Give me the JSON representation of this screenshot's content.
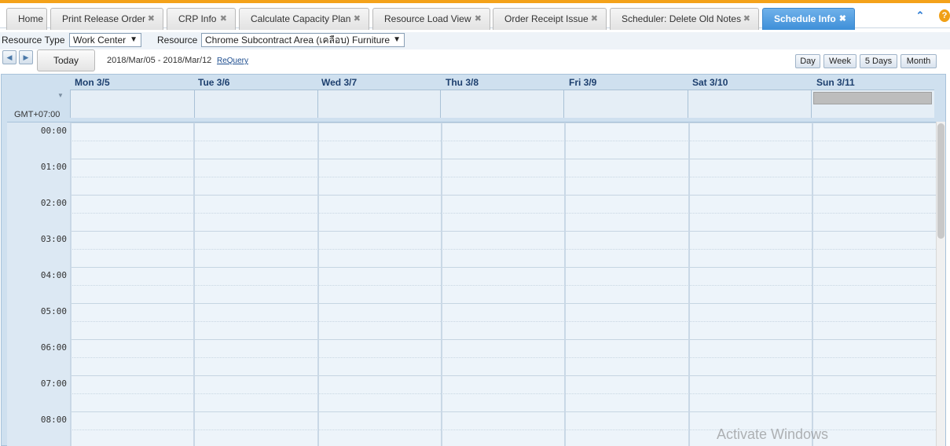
{
  "tabs": [
    {
      "label": "Home",
      "close": ""
    },
    {
      "label": "Print Release Order",
      "close": "✖"
    },
    {
      "label": "CRP Info",
      "close": "✖"
    },
    {
      "label": "Calculate Capacity Plan",
      "close": "✖"
    },
    {
      "label": "Resource Load View",
      "close": "✖"
    },
    {
      "label": "Order Receipt Issue",
      "close": "✖"
    },
    {
      "label": "Scheduler: Delete Old Notes",
      "close": "✖"
    },
    {
      "label": "Schedule Info",
      "close": "✖",
      "active": true
    }
  ],
  "toolbar_icons": {
    "collapse": "⌃",
    "help": "?"
  },
  "filters": {
    "resource_type_label": "Resource Type",
    "resource_type_value": "Work Center",
    "resource_label": "Resource",
    "resource_value": "Chrome Subcontract Area (เคลือบ) Furniture",
    "caret": "▼"
  },
  "navigation": {
    "prev": "◀",
    "next": "▶",
    "today": "Today",
    "date_range": "2018/Mar/05 - 2018/Mar/12",
    "requery": "ReQuery"
  },
  "views": [
    "Day",
    "Week",
    "5 Days",
    "Month"
  ],
  "calendar": {
    "days": [
      "Mon 3/5",
      "Tue 3/6",
      "Wed 3/7",
      "Thu 3/8",
      "Fri 3/9",
      "Sat 3/10",
      "Sun 3/11"
    ],
    "timezone": "GMT+07:00",
    "allday_toggle": "▼",
    "hours": [
      "00:00",
      "01:00",
      "02:00",
      "03:00",
      "04:00",
      "05:00",
      "06:00",
      "07:00",
      "08:00"
    ]
  },
  "watermark": "Activate Windows",
  "colors": {
    "accent": "#3e8fd8",
    "top_stripe": "#f4a21a",
    "grid_bg": "#edf4fa"
  }
}
